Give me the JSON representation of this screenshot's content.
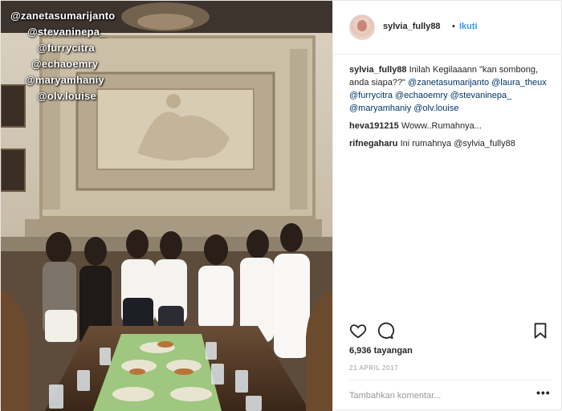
{
  "media": {
    "overlay_tags": [
      "@zanetasumarijanto",
      "@stevaninepa_",
      "@furrycitra",
      "@echaoemry",
      "@maryamhaniy",
      "@olv.louise"
    ]
  },
  "header": {
    "username": "sylvia_fully88",
    "separator": "•",
    "follow_label": "Ikuti"
  },
  "caption": {
    "username": "sylvia_fully88",
    "text": "Inilah Kegilaaann \"kan sombong, anda siapa??\"",
    "mentions": "@zanetasumarijanto @laura_theux @furrycitra @echaoemry @stevaninepa_ @maryamhaniy @olv.louise"
  },
  "comments": [
    {
      "username": "heva191215",
      "text": "Woww..Rumahnya..."
    },
    {
      "username": "rifnegaharu",
      "text": "Ini rumahnya @sylvia_fully88"
    }
  ],
  "stats": {
    "views": "6,936 tayangan",
    "date": "21 APRIL 2017"
  },
  "comment_box": {
    "placeholder": "Tambahkan komentar...",
    "more_label": "•••"
  },
  "icons": {
    "like": "heart-icon",
    "comment": "comment-bubble-icon",
    "save": "bookmark-icon"
  }
}
